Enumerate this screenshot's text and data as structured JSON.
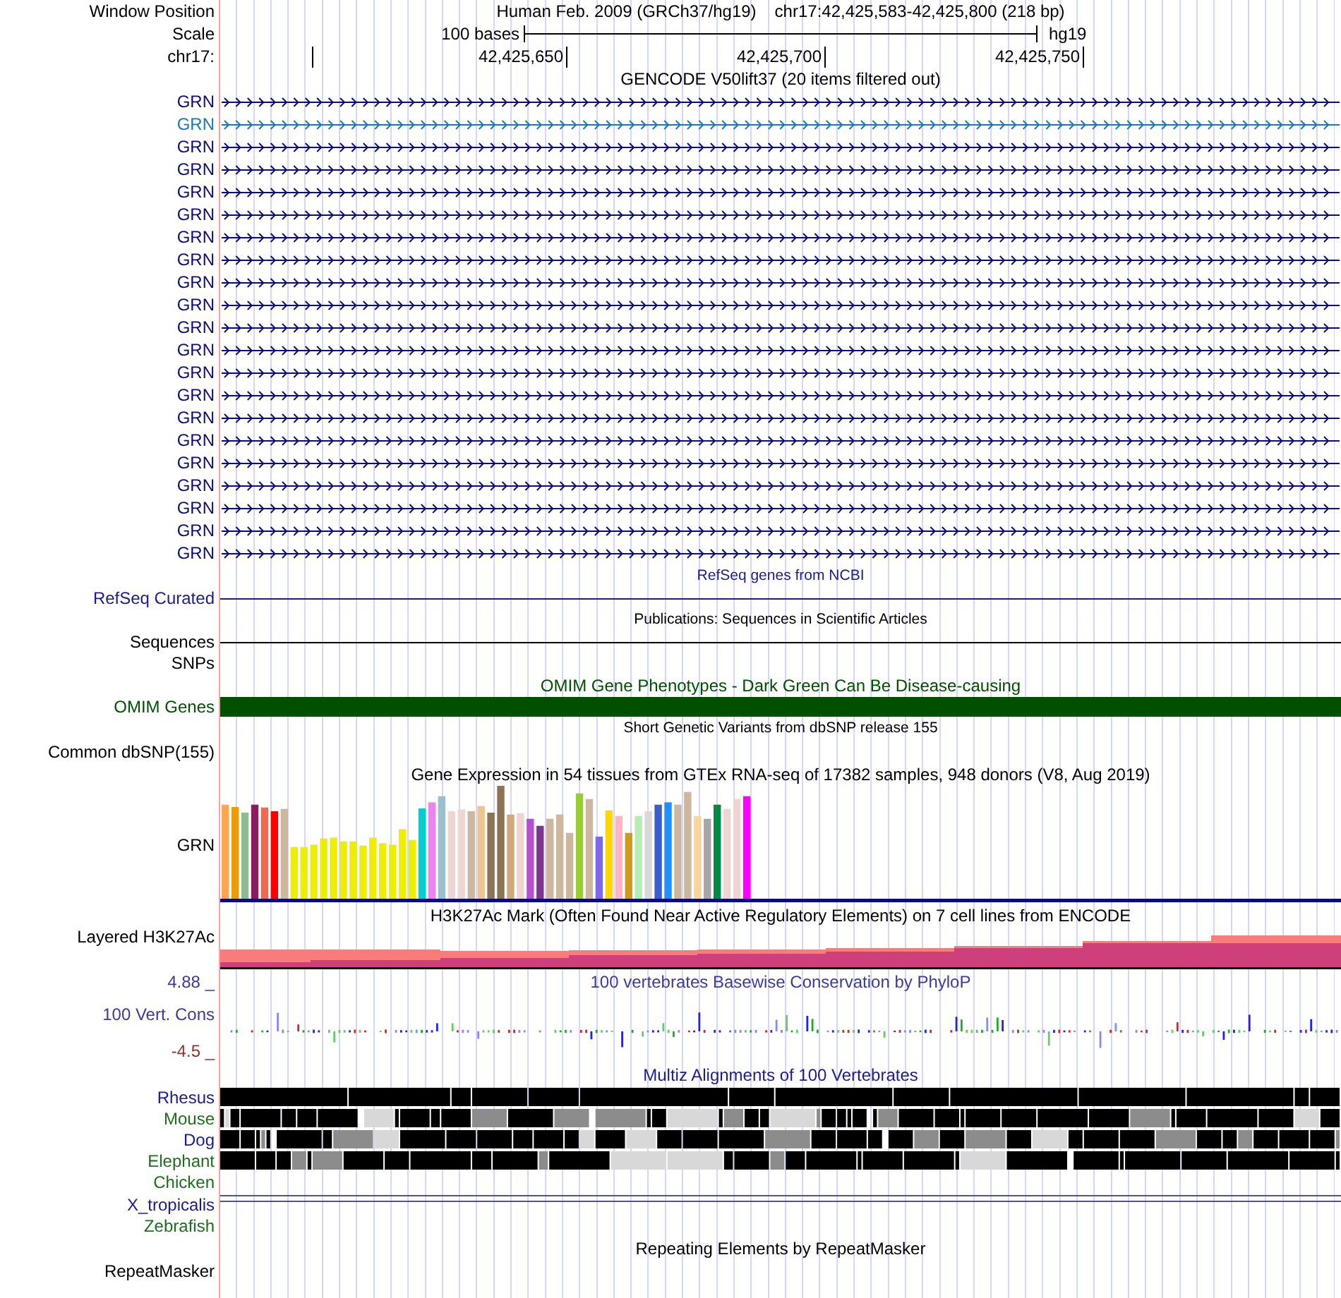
{
  "header": {
    "label": "Window Position",
    "assembly": "Human Feb. 2009 (GRCh37/hg19)",
    "position": "chr17:42,425,583-42,425,800 (218 bp)"
  },
  "scale": {
    "label": "Scale",
    "length": "100 bases",
    "assembly": "hg19"
  },
  "ruler": {
    "label": "chr17:",
    "ticks": [
      "42,425,650",
      "42,425,700",
      "42,425,750"
    ]
  },
  "tracks": [
    {
      "kind": "main",
      "title": "GENCODE V50lift37 (20 items filtered out)",
      "color": "#000000",
      "rows": [
        {
          "kind": "transcript",
          "label": "GRN",
          "color": "#0c0c78"
        },
        {
          "kind": "transcript",
          "label": "GRN",
          "color": "#1a78b8"
        },
        {
          "kind": "transcript",
          "label": "GRN",
          "color": "#0c0c78"
        },
        {
          "kind": "transcript",
          "label": "GRN",
          "color": "#0c0c78"
        },
        {
          "kind": "transcript",
          "label": "GRN",
          "color": "#0c0c78"
        },
        {
          "kind": "transcript",
          "label": "GRN",
          "color": "#0c0c78"
        },
        {
          "kind": "transcript",
          "label": "GRN",
          "color": "#0c0c78"
        },
        {
          "kind": "transcript",
          "label": "GRN",
          "color": "#0c0c78"
        },
        {
          "kind": "transcript",
          "label": "GRN",
          "color": "#0c0c78"
        },
        {
          "kind": "transcript",
          "label": "GRN",
          "color": "#0c0c78"
        },
        {
          "kind": "transcript",
          "label": "GRN",
          "color": "#0c0c78"
        },
        {
          "kind": "transcript",
          "label": "GRN",
          "color": "#0c0c78"
        },
        {
          "kind": "transcript",
          "label": "GRN",
          "color": "#0c0c78"
        },
        {
          "kind": "transcript",
          "label": "GRN",
          "color": "#0c0c78"
        },
        {
          "kind": "transcript",
          "label": "GRN",
          "color": "#0c0c78"
        },
        {
          "kind": "transcript",
          "label": "GRN",
          "color": "#0c0c78"
        },
        {
          "kind": "transcript",
          "label": "GRN",
          "color": "#0c0c78"
        },
        {
          "kind": "transcript",
          "label": "GRN",
          "color": "#0c0c78"
        },
        {
          "kind": "transcript",
          "label": "GRN",
          "color": "#0c0c78"
        },
        {
          "kind": "transcript",
          "label": "GRN",
          "color": "#0c0c78"
        },
        {
          "kind": "transcript",
          "label": "GRN",
          "color": "#0c0c78"
        }
      ]
    },
    {
      "kind": "minor",
      "title": "RefSeq genes from NCBI",
      "color": "#1c1c8c",
      "rows": [
        {
          "kind": "line",
          "label": "RefSeq Curated"
        }
      ]
    },
    {
      "kind": "minor",
      "title": "Publications: Sequences in Scientific Articles",
      "color": "#000000",
      "rows": [
        {
          "kind": "line",
          "label": "Sequences"
        },
        {
          "kind": "empty",
          "label": "SNPs"
        }
      ]
    },
    {
      "kind": "main",
      "title": "OMIM Gene Phenotypes - Dark Green Can Be Disease-causing",
      "color": "#005000",
      "rows": [
        {
          "kind": "bar",
          "label": "OMIM Genes"
        }
      ]
    },
    {
      "kind": "minor",
      "title": "Short Genetic Variants from dbSNP release 155",
      "color": "#000000",
      "rows": [
        {
          "kind": "empty",
          "label": "Common dbSNP(155)"
        }
      ]
    },
    {
      "kind": "main",
      "title": "Gene Expression in 54 tissues from GTEx RNA-seq of 17382 samples, 948 donors (V8, Aug 2019)",
      "color": "#000000",
      "rows": [
        {
          "kind": "expression",
          "label": "GRN"
        }
      ]
    },
    {
      "kind": "main",
      "title": "H3K27Ac Mark (Often Found Near Active Regulatory Elements) on 7 cell lines from ENCODE",
      "color": "#000000",
      "rows": [
        {
          "kind": "layered",
          "label": "Layered H3K27Ac"
        }
      ]
    },
    {
      "kind": "wiggle",
      "title": "100 vertebrates Basewise Conservation by PhyloP",
      "color": "#3c3c96",
      "label": "100 Vert. Cons",
      "max": "4.88 _",
      "min": "-4.5 _"
    },
    {
      "kind": "main",
      "title": "Multiz Alignments of 100 Vertebrates",
      "color": "#1c1c8c",
      "rows": [
        {
          "kind": "alignment",
          "label": "Rhesus",
          "color": "#1c1c8c"
        },
        {
          "kind": "alignment",
          "label": "Mouse",
          "color": "#1e6e1e"
        },
        {
          "kind": "alignment",
          "label": "Dog",
          "color": "#1c1c8c"
        },
        {
          "kind": "alignment",
          "label": "Elephant",
          "color": "#1e6e1e"
        },
        {
          "kind": "empty",
          "label": "Chicken",
          "color": "#1e6e1e"
        },
        {
          "kind": "double-line",
          "label": "X_tropicalis",
          "color": "#1c1c8c"
        },
        {
          "kind": "empty",
          "label": "Zebrafish",
          "color": "#1e6e1e"
        }
      ]
    },
    {
      "kind": "main",
      "title": "Repeating Elements by RepeatMasker",
      "color": "#000000",
      "rows": [
        {
          "kind": "empty",
          "label": "RepeatMasker"
        }
      ]
    }
  ]
}
